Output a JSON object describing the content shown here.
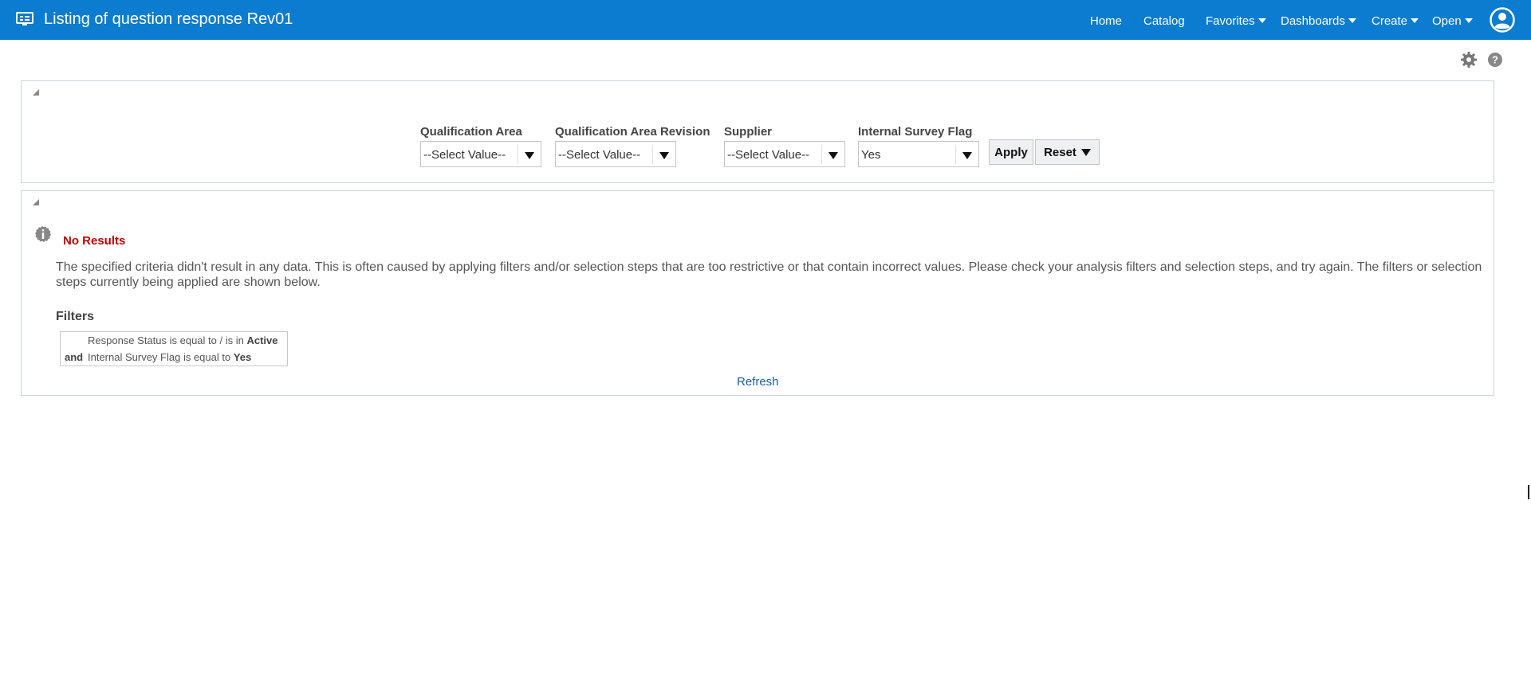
{
  "header": {
    "title": "Listing of question response Rev01",
    "nav": [
      {
        "label": "Home",
        "has_menu": false
      },
      {
        "label": "Catalog",
        "has_menu": false
      },
      {
        "label": "Favorites",
        "has_menu": true
      },
      {
        "label": "Dashboards",
        "has_menu": true
      },
      {
        "label": "Create",
        "has_menu": true
      },
      {
        "label": "Open",
        "has_menu": true
      }
    ],
    "user_icon": "user-avatar-icon",
    "app_icon": "dashboard-monitor-icon"
  },
  "page_tools": {
    "settings_icon": "gear-icon",
    "help_icon": "help-icon"
  },
  "prompts": {
    "fields": [
      {
        "label": "Qualification Area",
        "value": "--Select Value--"
      },
      {
        "label": "Qualification Area Revision",
        "value": "--Select Value--"
      },
      {
        "label": "Supplier",
        "value": "--Select Value--"
      },
      {
        "label": "Internal Survey Flag",
        "value": "Yes"
      }
    ],
    "apply_label": "Apply",
    "reset_label": "Reset"
  },
  "results": {
    "title": "No Results",
    "message": "The specified criteria didn't result in any data. This is often caused by applying filters and/or selection steps that are too restrictive or that contain incorrect values. Please check your analysis filters and selection steps, and try again. The filters or selection steps currently being applied are shown below.",
    "filters_title": "Filters",
    "filters": [
      {
        "conj": "",
        "text": "Response Status is equal to / is in",
        "value": "Active"
      },
      {
        "conj": "and",
        "text": "Internal Survey Flag is equal to",
        "value": "Yes"
      }
    ],
    "refresh_label": "Refresh"
  },
  "colors": {
    "header_bg": "#0b7ccf",
    "no_results": "#c00000",
    "link": "#1c5d99"
  }
}
